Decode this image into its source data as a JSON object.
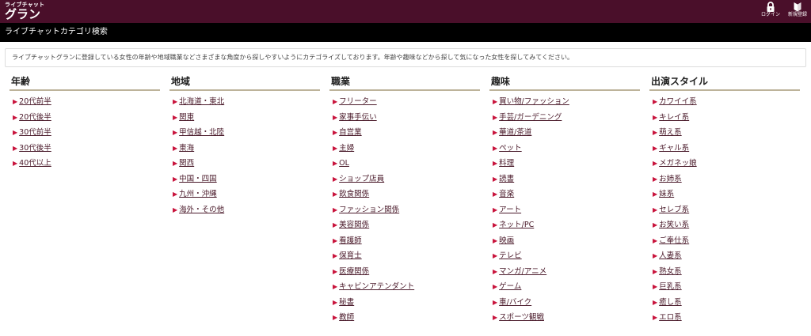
{
  "header": {
    "logo_sub": "ライブチャット",
    "logo_main": "グラン",
    "login_label": "ログイン",
    "register_label": "新規登録"
  },
  "page_title": "ライブチャットカテゴリ検索",
  "intro_text": "ライブチャットグランに登録している女性の年齢や地域職業などさまざまな角度から探しやすいようにカテゴライズしております。年齢や趣味などから探して気になった女性を探してみてください。",
  "arrow_glyph": "▶",
  "colors": {
    "brand": "#4a0f2a",
    "arrow": "#c8143c",
    "link": "#4a1a2a",
    "rule": "#bdb39a"
  },
  "categories": [
    {
      "heading": "年齢",
      "items": [
        "20代前半",
        "20代後半",
        "30代前半",
        "30代後半",
        "40代以上"
      ]
    },
    {
      "heading": "地域",
      "items": [
        "北海道・東北",
        "関東",
        "甲信越・北陸",
        "東海",
        "関西",
        "中国・四国",
        "九州・沖縄",
        "海外・その他"
      ]
    },
    {
      "heading": "職業",
      "items": [
        "フリーター",
        "家事手伝い",
        "自営業",
        "主婦",
        "OL",
        "ショップ店員",
        "飲食関係",
        "ファッション関係",
        "美容関係",
        "看護師",
        "保育士",
        "医療関係",
        "キャビンアテンダント",
        "秘書",
        "教師"
      ]
    },
    {
      "heading": "趣味",
      "items": [
        "買い物/ファッション",
        "手芸/ガーデニング",
        "華道/茶道",
        "ペット",
        "料理",
        "読書",
        "音楽",
        "アート",
        "ネット/PC",
        "映画",
        "テレビ",
        "マンガ/アニメ",
        "ゲーム",
        "車/バイク",
        "スポーツ観戦"
      ]
    },
    {
      "heading": "出演スタイル",
      "items": [
        "カワイイ系",
        "キレイ系",
        "萌え系",
        "ギャル系",
        "メガネッ娘",
        "お姉系",
        "妹系",
        "セレブ系",
        "お笑い系",
        "ご奉仕系",
        "人妻系",
        "熟女系",
        "巨乳系",
        "癒し系",
        "エロ系"
      ]
    }
  ]
}
